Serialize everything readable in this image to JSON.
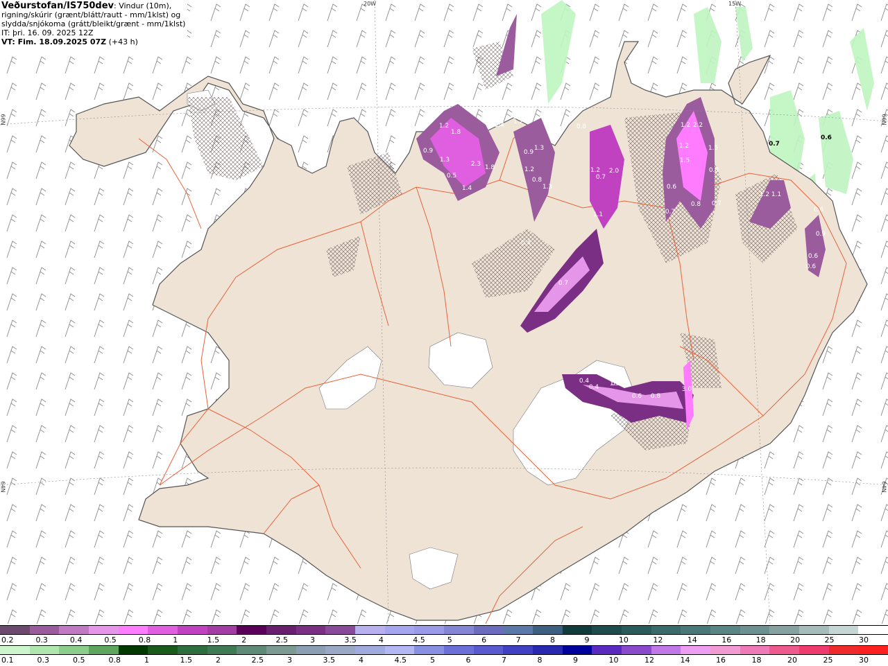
{
  "header": {
    "org": "Veðurstofan/IS750dev",
    "desc1": ": Vindur (10m),",
    "desc2": "rigning/skúrir (grænt/blátt/rautt - mm/1klst) og",
    "desc3": "slydda/snjókoma (grátt/bleikt/grænt - mm/1klst)",
    "it_line": "IT: þri. 16. 09. 2025 12Z",
    "vt_label": "VT: Fim. 18.09.2025 07Z",
    "vt_suffix": " (+43 h)"
  },
  "grid_labels": {
    "lon_20w": "20W",
    "lon_15w": "15W",
    "lat_66n": "66N",
    "lat_64n": "64N"
  },
  "precip_labels": [
    "1.2",
    "1.8",
    "0.9",
    "1.3",
    "0.5",
    "1.4",
    "1.4",
    "1.2",
    "2.3",
    "1.8",
    "1.4",
    "1.2",
    "0.9",
    "1.2",
    "1.3",
    "0.8",
    "0.8",
    "1.2",
    "2.0",
    "0.7",
    "1.1",
    "0.4",
    "1.3",
    "0.7",
    "0.4",
    "1.2",
    "2.2",
    "1.2",
    "1.5",
    "1.5",
    "0.8",
    "0.7",
    "0.8",
    "0.6",
    "1.2",
    "1.1",
    "0.7",
    "0.6",
    "0.9",
    "0.6",
    "0.6",
    "0.4",
    "0.4",
    "0.4",
    "1.3",
    "0.6",
    "0.8",
    "3.0"
  ],
  "sea_precip_labels": [
    "0.7",
    "0.6"
  ],
  "colors": {
    "land": "#efe3d6",
    "coast": "#555555",
    "roads": "#e8623a",
    "glacier": "#ffffff",
    "snow_magenta": "#c95fe0",
    "rain_green": "#bff5c0",
    "barb": "#8a8a8a"
  },
  "legend_snow": {
    "colors": [
      "#6d4a6d",
      "#9b5c9e",
      "#c07ac3",
      "#e596e9",
      "#ff7bff",
      "#e05ee0",
      "#c142c1",
      "#a33da3",
      "#5a005a",
      "#6a1e6e",
      "#7b2f84",
      "#8a4a9a",
      "#b8b0ef",
      "#a6a6f0",
      "#9a9ae8",
      "#8585d6",
      "#6c6cbe",
      "#5a78a8",
      "#3e6080",
      "#123c3c",
      "#1e4c4c",
      "#2a5a5a",
      "#3a6a6a",
      "#4a7777",
      "#5a8585",
      "#6d9090",
      "#85a2a0",
      "#a6bcba",
      "#c6d6d4",
      "#ffffff"
    ],
    "labels": [
      "0.2",
      "0.3",
      "0.4",
      "0.5",
      "0.8",
      "1",
      "1.5",
      "2",
      "2.5",
      "3",
      "3.5",
      "4",
      "4.5",
      "5",
      "6",
      "7",
      "8",
      "9",
      "10",
      "12",
      "14",
      "16",
      "18",
      "20",
      "25",
      "30"
    ]
  },
  "legend_rain": {
    "colors": [
      "#ccf5cc",
      "#aee6ae",
      "#8ccd8c",
      "#5ea55e",
      "#003a00",
      "#1a5a1a",
      "#2e6e3e",
      "#3f7a55",
      "#5f8a78",
      "#7a9a92",
      "#8aa0b2",
      "#9aa8c6",
      "#a0aadc",
      "#b4b8f2",
      "#8890e2",
      "#6a70d8",
      "#5a5ad0",
      "#4040c2",
      "#2828b0",
      "#00009a",
      "#5a2ac0",
      "#8a4acc",
      "#c078e6",
      "#ee9ef0",
      "#f29ad2",
      "#ef7ab8",
      "#ef5a8e",
      "#ef3a6e",
      "#ee2a2a",
      "#ff2020"
    ],
    "labels": [
      "0.1",
      "0.3",
      "0.5",
      "0.8",
      "1",
      "1.5",
      "2",
      "2.5",
      "3",
      "3.5",
      "4",
      "4.5",
      "5",
      "6",
      "7",
      "8",
      "9",
      "10",
      "12",
      "14",
      "16",
      "18",
      "20",
      "25",
      "30"
    ]
  }
}
